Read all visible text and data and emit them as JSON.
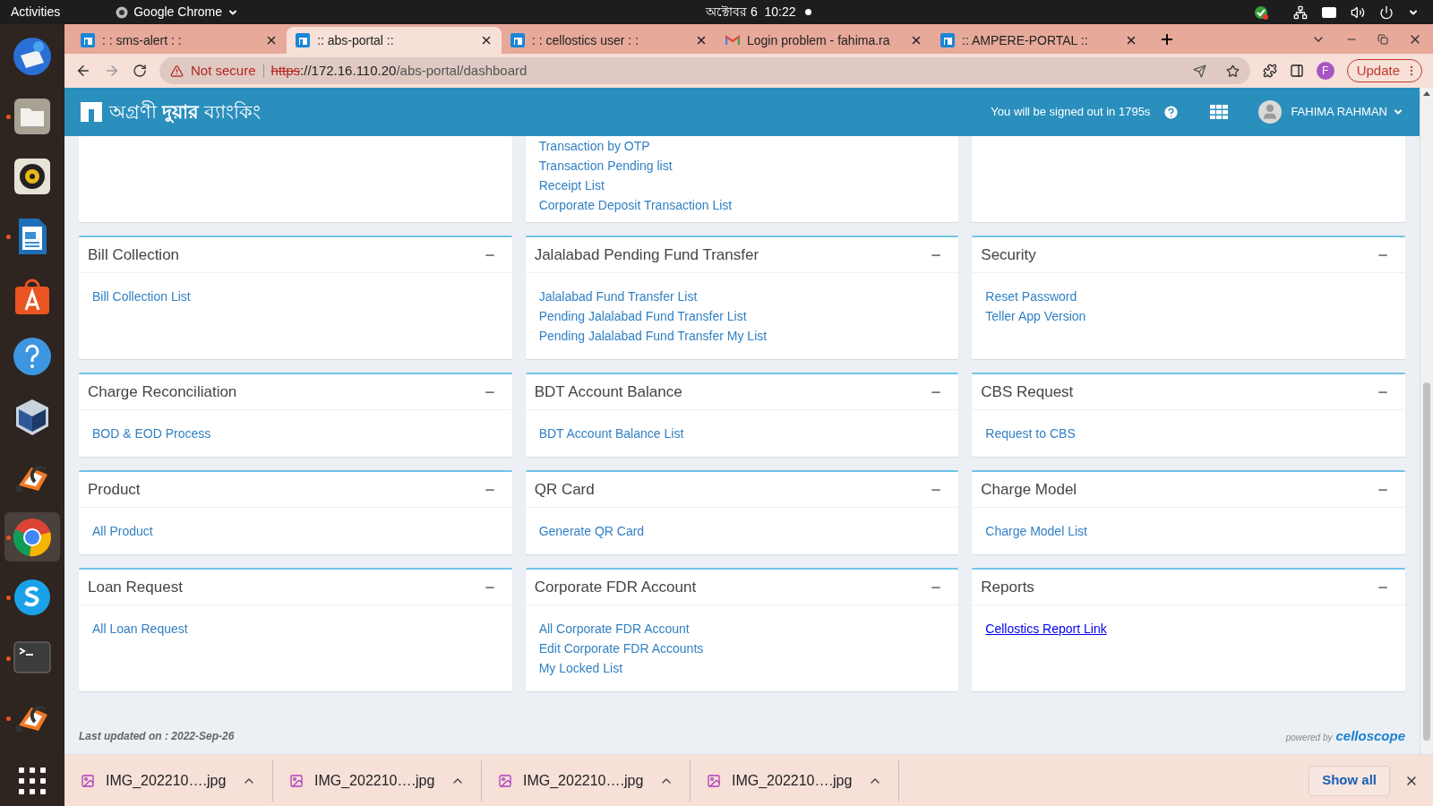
{
  "system_bar": {
    "activities": "Activities",
    "app_menu": "Google Chrome",
    "clock": "অক্টোবর 6  10:22"
  },
  "dock": {
    "items": [
      {
        "kind": "mail",
        "running": false,
        "selected": false
      },
      {
        "kind": "files",
        "running": true,
        "selected": false
      },
      {
        "kind": "music",
        "running": false,
        "selected": false
      },
      {
        "kind": "writer",
        "running": true,
        "selected": false
      },
      {
        "kind": "store",
        "running": false,
        "selected": false
      },
      {
        "kind": "help",
        "running": false,
        "selected": false
      },
      {
        "kind": "box",
        "running": false,
        "selected": false
      },
      {
        "kind": "headset",
        "running": false,
        "selected": false
      },
      {
        "kind": "chrome",
        "running": true,
        "selected": true
      },
      {
        "kind": "skype",
        "running": true,
        "selected": false
      },
      {
        "kind": "terminal",
        "running": true,
        "selected": false
      },
      {
        "kind": "headset",
        "running": true,
        "selected": false
      },
      {
        "kind": "apps",
        "running": false,
        "selected": false
      }
    ]
  },
  "browser": {
    "tabs": [
      {
        "title": ": : sms-alert : :",
        "kind": "portal",
        "selected": false
      },
      {
        "title": ":: abs-portal ::",
        "kind": "portal",
        "selected": true
      },
      {
        "title": ": : cellostics user : :",
        "kind": "portal",
        "selected": false
      },
      {
        "title": "Login problem - fahima.ra",
        "kind": "mail",
        "selected": false
      },
      {
        "title": ":: AMPERE-PORTAL ::",
        "kind": "portal",
        "selected": false
      }
    ],
    "security": "Not secure",
    "url_scheme": "https",
    "url_host": "://172.16.110.20",
    "url_path": "/abs-portal/dashboard",
    "profile": "F",
    "update": "Update"
  },
  "page": {
    "brand": "অগ্রণী **দুয়ার** ব্যাংকিং",
    "signout": "You will be signed out in 1795s",
    "user": "FAHIMA RAHMAN",
    "rows": [
      [
        {
          "kind": "cut"
        },
        {
          "kind": "cut",
          "links": [
            "Transaction by OTP",
            "Transaction Pending list",
            "Receipt List",
            "Corporate Deposit Transaction List"
          ]
        },
        {
          "kind": "cut"
        }
      ],
      [
        {
          "kind": "full",
          "title": "Bill Collection",
          "links": [
            "Bill Collection List"
          ]
        },
        {
          "kind": "full",
          "title": "Jalalabad Pending Fund Transfer",
          "links": [
            "Jalalabad Fund Transfer List",
            "Pending Jalalabad Fund Transfer List",
            "Pending Jalalabad Fund Transfer My List"
          ]
        },
        {
          "kind": "full",
          "title": "Security",
          "links": [
            "Reset Password",
            "Teller App Version"
          ]
        }
      ],
      [
        {
          "kind": "full",
          "title": "Charge Reconciliation",
          "links": [
            "BOD & EOD Process"
          ]
        },
        {
          "kind": "full",
          "title": "BDT Account Balance",
          "links": [
            "BDT Account Balance List"
          ]
        },
        {
          "kind": "full",
          "title": "CBS Request",
          "links": [
            "Request to CBS"
          ]
        }
      ],
      [
        {
          "kind": "full",
          "title": "Product",
          "links": [
            "All Product"
          ]
        },
        {
          "kind": "full",
          "title": "QR Card",
          "links": [
            "Generate QR Card"
          ]
        },
        {
          "kind": "full",
          "title": "Charge Model",
          "links": [
            "Charge Model List"
          ]
        }
      ],
      [
        {
          "kind": "full",
          "title": "Loan Request",
          "links": [
            "All Loan Request"
          ]
        },
        {
          "kind": "full",
          "title": "Corporate FDR Account",
          "links": [
            "All Corporate FDR Account",
            "Edit Corporate FDR Accounts",
            "My Locked List"
          ]
        },
        {
          "kind": "external",
          "title": "Reports",
          "links": [
            "Cellostics Report Link"
          ]
        }
      ]
    ],
    "last_updated": "Last updated on : 2022-Sep-26",
    "powered_by": "powered by",
    "maker": "celloscope"
  },
  "downloads": {
    "items": [
      "IMG_202210….jpg",
      "IMG_202210….jpg",
      "IMG_202210….jpg",
      "IMG_202210….jpg"
    ],
    "show_all": "Show all"
  }
}
